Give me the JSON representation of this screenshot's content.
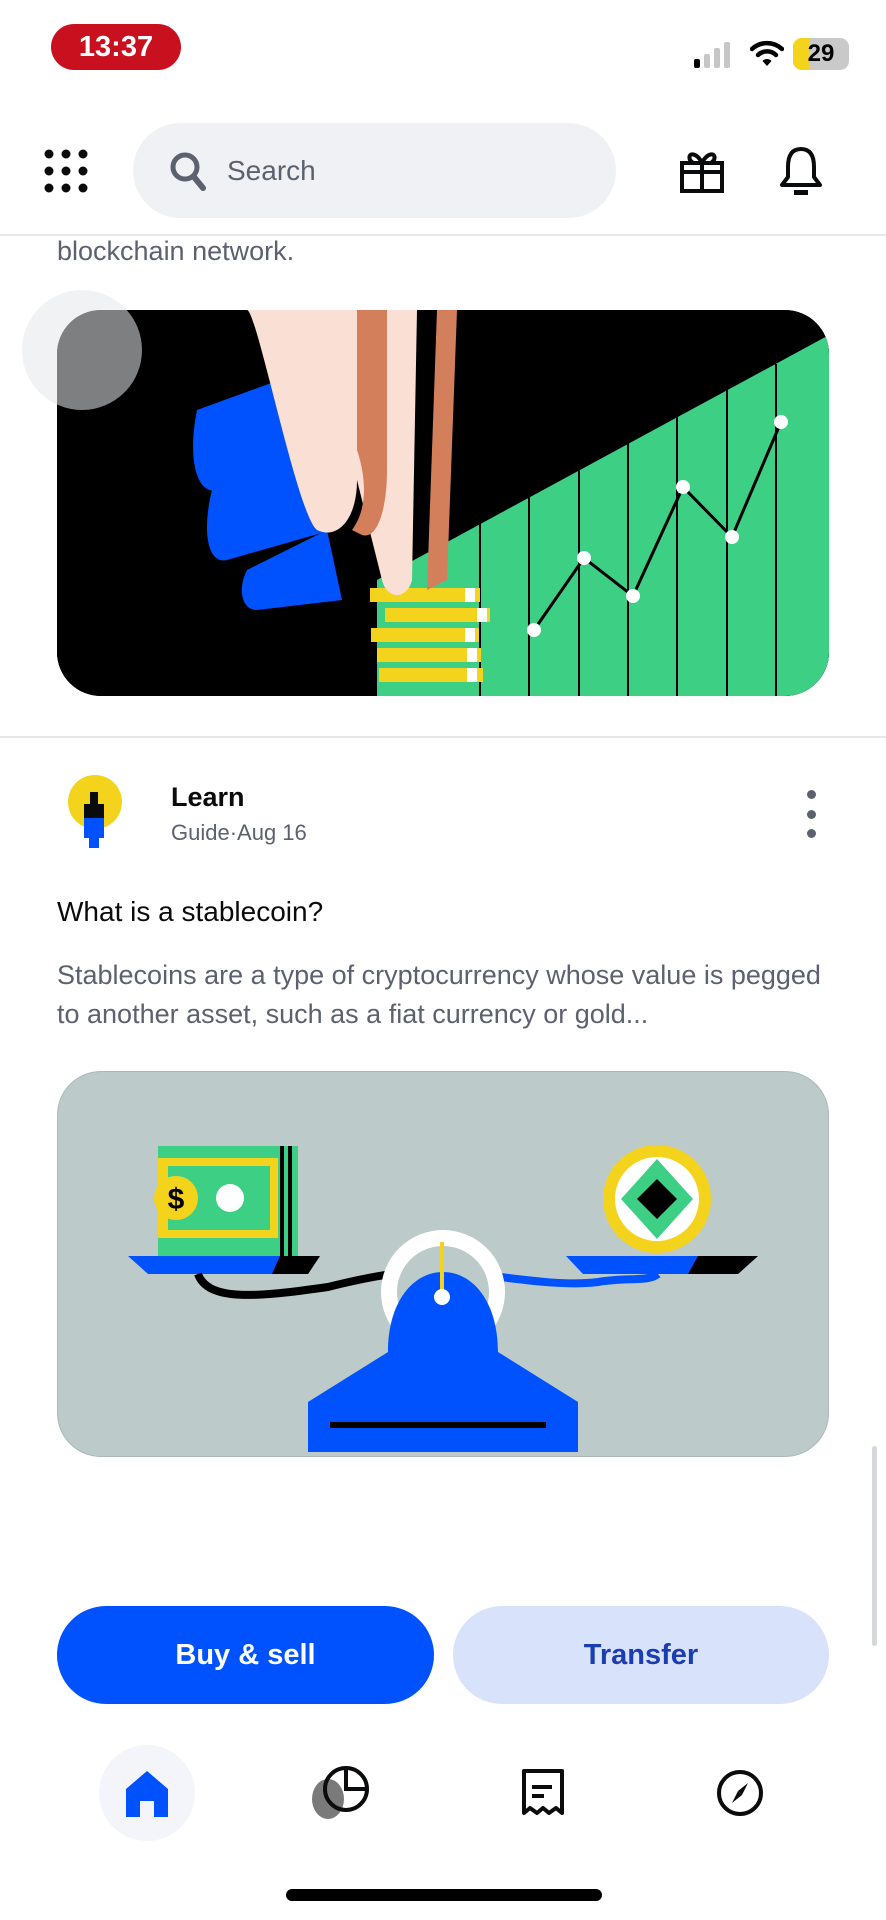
{
  "status_bar": {
    "time": "13:37",
    "battery_level": "29",
    "signal_icon": "signal-icon",
    "wifi_icon": "wifi-icon"
  },
  "header": {
    "menu_icon": "grid-menu-icon",
    "search_placeholder": "Search",
    "search_icon": "search-icon",
    "gift_icon": "gift-icon",
    "notifications_icon": "bell-icon"
  },
  "feed": {
    "previous_item": {
      "text_tail": "blockchain network.",
      "image_alt": "Hand placing coins in front of rising green chart"
    },
    "article": {
      "source": "Learn",
      "meta": "Guide·Aug 16",
      "title": "What is a stablecoin?",
      "description": "Stablecoins are a type of cryptocurrency whose value is pegged to another asset, such as a fiat currency or gold...",
      "image_alt": "Scale balancing a dollar bill and a coin",
      "more_icon": "more-vertical-icon"
    }
  },
  "actions": {
    "buy_sell_label": "Buy & sell",
    "transfer_label": "Transfer"
  },
  "tab_bar": {
    "tabs": [
      {
        "name": "home",
        "icon": "home-icon",
        "active": true
      },
      {
        "name": "assets",
        "icon": "pie-chart-icon",
        "active": false
      },
      {
        "name": "activity",
        "icon": "receipt-icon",
        "active": false
      },
      {
        "name": "explore",
        "icon": "compass-icon",
        "active": false
      }
    ]
  },
  "colors": {
    "brand_blue": "#0052ff",
    "transfer_bg": "#d8e3fb",
    "time_pill": "#c8101f",
    "chart_green": "#3dd085",
    "coin_yellow": "#f4d31d"
  }
}
